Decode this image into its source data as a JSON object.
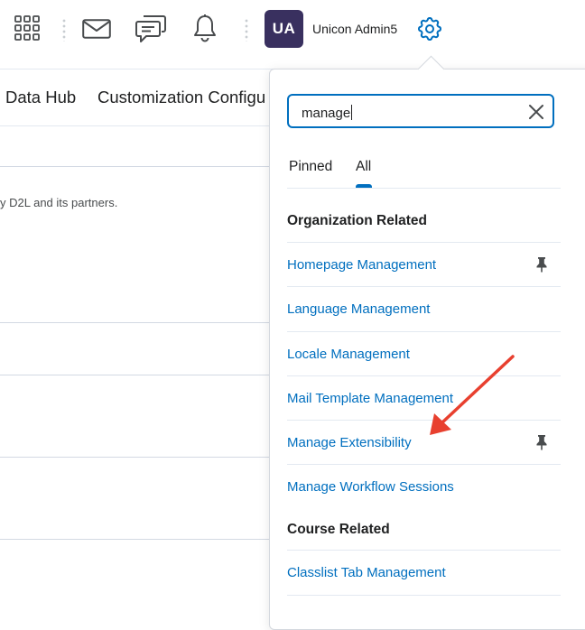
{
  "header": {
    "user_initials": "UA",
    "user_name": "Unicon Admin5",
    "icons": [
      "waffle-grid-icon",
      "mail-icon",
      "chat-icon",
      "bell-icon",
      "gear-icon"
    ]
  },
  "navbar": {
    "links": [
      "Data Hub",
      "Customization Configu"
    ]
  },
  "background": {
    "text": "y D2L and its partners."
  },
  "admin_panel": {
    "search": {
      "value": "manage"
    },
    "tabs": [
      "Pinned",
      "All"
    ],
    "active_tab": "All",
    "sections": [
      {
        "title": "Organization Related",
        "items": [
          {
            "label": "Homepage Management",
            "pinned": true
          },
          {
            "label": "Language Management",
            "pinned": false
          },
          {
            "label": "Locale Management",
            "pinned": false
          },
          {
            "label": "Mail Template Management",
            "pinned": false
          },
          {
            "label": "Manage Extensibility",
            "pinned": true
          },
          {
            "label": "Manage Workflow Sessions",
            "pinned": false
          }
        ]
      },
      {
        "title": "Course Related",
        "items": [
          {
            "label": "Classlist Tab Management",
            "pinned": false
          }
        ]
      }
    ]
  },
  "colors": {
    "link": "#006fbf",
    "avatar_bg": "#39305f",
    "annotation_arrow": "#e8402f"
  }
}
